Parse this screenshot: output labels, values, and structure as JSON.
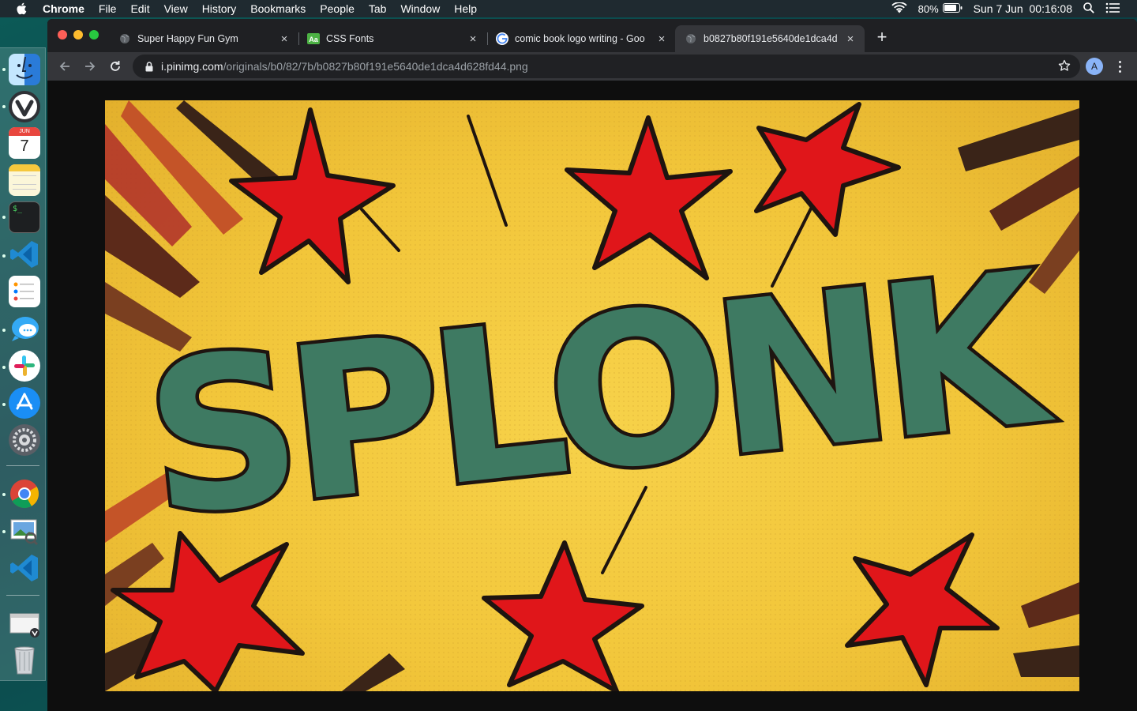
{
  "menubar": {
    "app_name": "Chrome",
    "items": [
      "File",
      "Edit",
      "View",
      "History",
      "Bookmarks",
      "People",
      "Tab",
      "Window",
      "Help"
    ],
    "battery": "80%",
    "datetime": "Sun 7 Jun  00:16:08"
  },
  "dock": {
    "apps": [
      "finder-icon",
      "vivaldi-icon",
      "calendar-icon",
      "notes-icon",
      "terminal-icon",
      "vscode-icon",
      "reminders-icon",
      "messages-icon",
      "slack-icon",
      "app-store-icon",
      "system-preferences-icon",
      "chrome-icon",
      "preview-icon",
      "vscode-icon",
      "vivaldi-downloads-icon",
      "trash-icon"
    ],
    "calendar_month": "JUN",
    "calendar_day": "7"
  },
  "browser": {
    "tabs": [
      {
        "title": "Super Happy Fun Gym",
        "active": false
      },
      {
        "title": "CSS Fonts",
        "active": false
      },
      {
        "title": "comic book logo writing - Goo",
        "active": false
      },
      {
        "title": "b0827b80f191e5640de1dca4d",
        "active": true
      }
    ],
    "url_host": "i.pinimg.com",
    "url_path": "/originals/b0/82/7b/b0827b80f191e5640de1dca4d628fd44.png",
    "profile_initial": "A"
  },
  "image": {
    "comic_word": "SPLONK",
    "colors": {
      "background": "#f2c63a",
      "star": "#e0161a",
      "letters": "#3e7a62",
      "outline": "#1e1410"
    }
  }
}
